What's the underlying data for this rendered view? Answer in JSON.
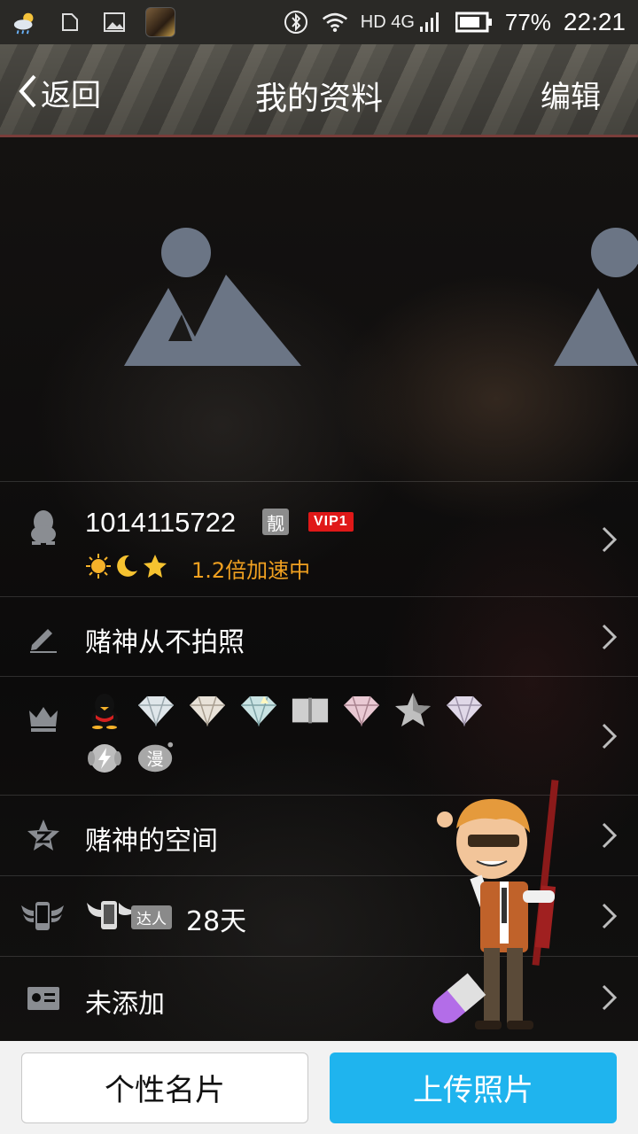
{
  "status_bar": {
    "network_label": "HD 4G",
    "battery_percent": "77%",
    "time": "22:21"
  },
  "header": {
    "back_label": "返回",
    "title": "我的资料",
    "edit_label": "编辑"
  },
  "profile": {
    "qq_number": "1014115722",
    "liang_badge": "靓",
    "vip_badge": "VIP1",
    "speed_text": "1.2倍加速中"
  },
  "signature": {
    "text": "赌神从不拍照"
  },
  "qzone": {
    "label": "赌神的空间"
  },
  "mobile": {
    "daren_label": "达人",
    "days": "28天"
  },
  "card": {
    "label": "未添加"
  },
  "bottom": {
    "card_button": "个性名片",
    "upload_button": "上传照片"
  },
  "colors": {
    "accent_blue": "#1fb4ee",
    "speed_orange": "#f0a020",
    "vip_red": "#e01818"
  }
}
